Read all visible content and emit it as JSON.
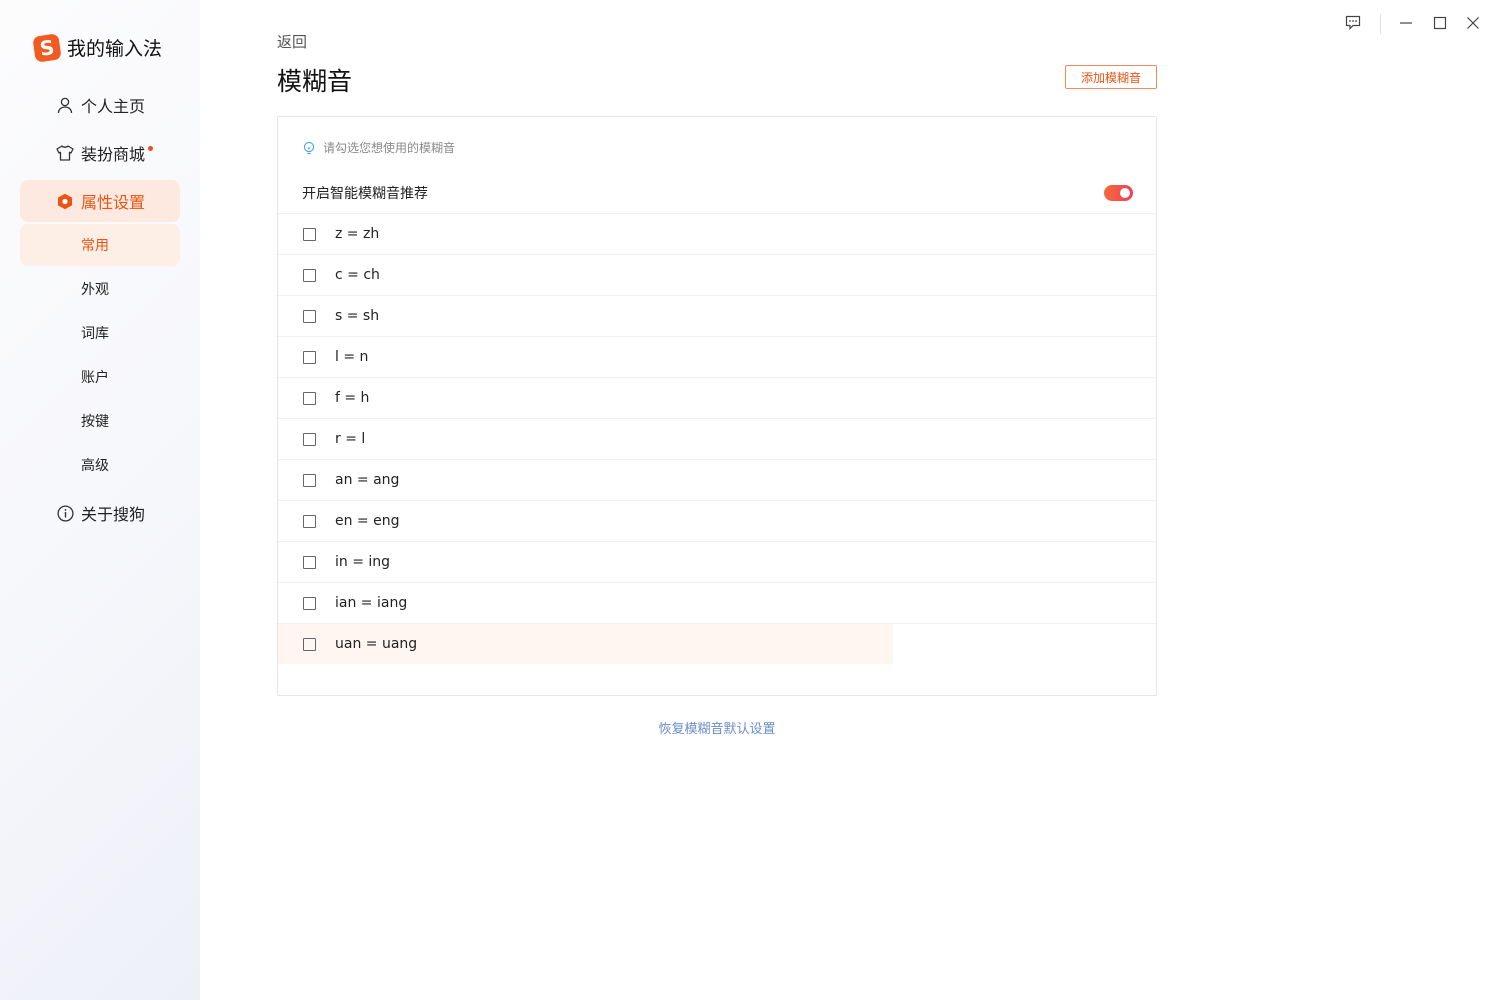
{
  "app": {
    "name": "我的输入法",
    "logo_letter": "S",
    "accent": "#ea5514"
  },
  "nav": {
    "home": "个人主页",
    "store": "装扮商城",
    "settings": "属性设置",
    "about": "关于搜狗",
    "sub": [
      "常用",
      "外观",
      "词库",
      "账户",
      "按键",
      "高级"
    ]
  },
  "header": {
    "back": "返回",
    "title": "模糊音",
    "add_button": "添加模糊音"
  },
  "panel": {
    "hint": "请勾选您想使用的模糊音",
    "smart_toggle_label": "开启智能模糊音推荐",
    "smart_toggle_on": true,
    "rules": [
      "z = zh",
      "c = ch",
      "s = sh",
      "l = n",
      "f = h",
      "r = l",
      "an = ang",
      "en = eng",
      "in = ing",
      "ian = iang",
      "uan = uang"
    ]
  },
  "footer": {
    "reset": "恢复模糊音默认设置"
  },
  "icons": {
    "feedback": "feedback-icon",
    "minimize": "minimize-icon",
    "maximize": "maximize-icon",
    "close": "close-icon"
  }
}
